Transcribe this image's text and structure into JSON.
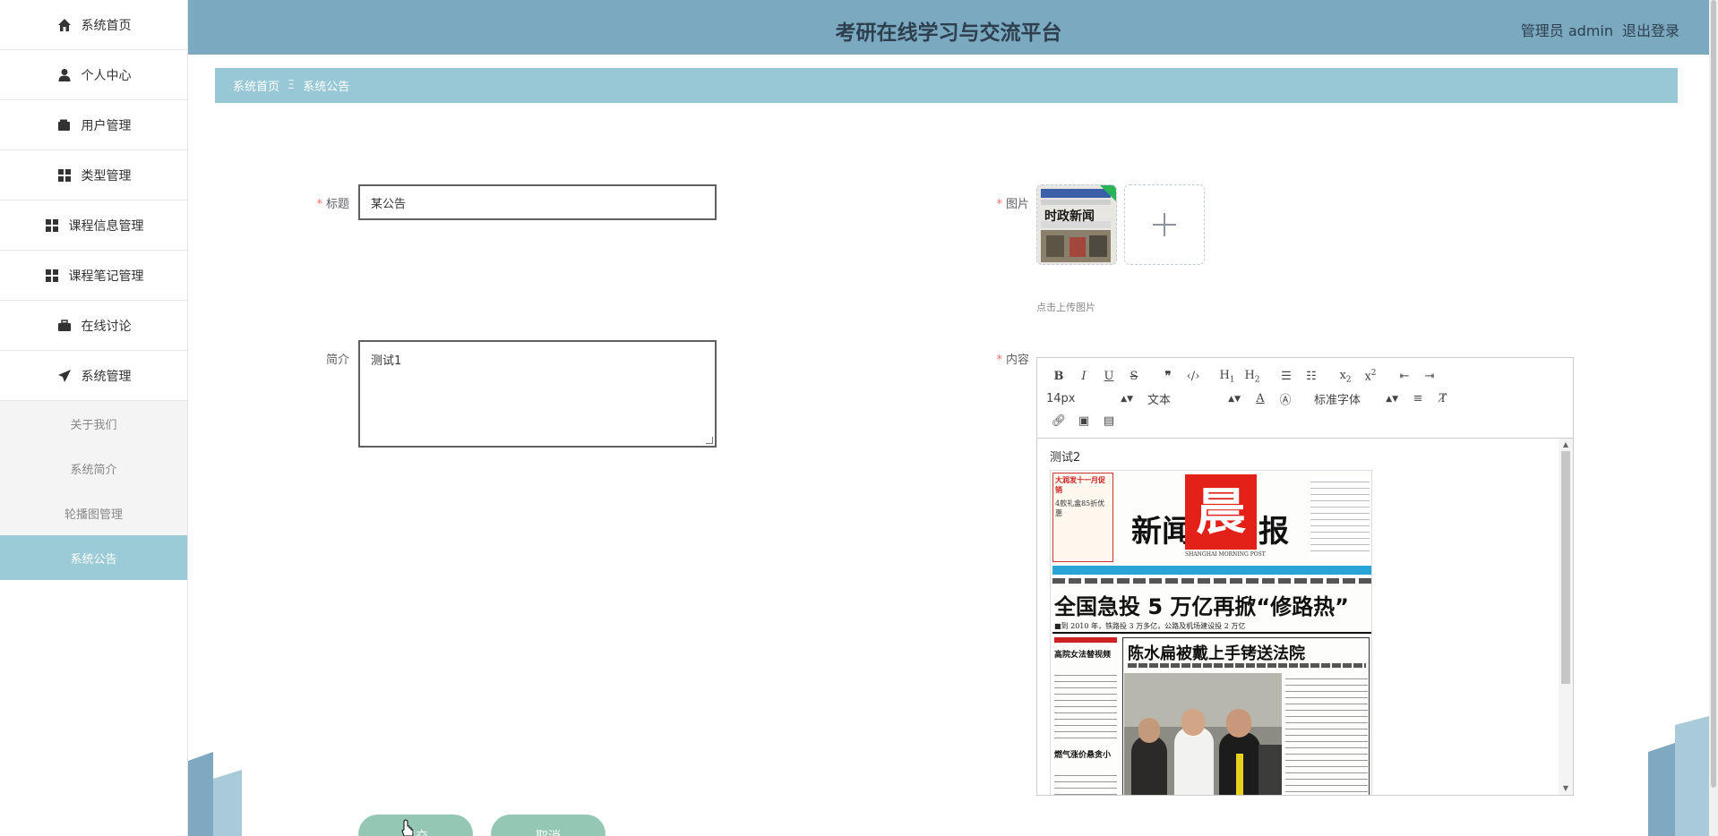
{
  "app": {
    "title": "考研在线学习与交流平台",
    "user_label": "管理员 admin",
    "logout_label": "退出登录"
  },
  "sidebar": {
    "items": [
      {
        "label": "系统首页",
        "icon": "home-icon"
      },
      {
        "label": "个人中心",
        "icon": "user-icon"
      },
      {
        "label": "用户管理",
        "icon": "wallet-icon"
      },
      {
        "label": "类型管理",
        "icon": "grid-icon"
      },
      {
        "label": "课程信息管理",
        "icon": "grid-icon"
      },
      {
        "label": "课程笔记管理",
        "icon": "grid-icon"
      },
      {
        "label": "在线讨论",
        "icon": "briefcase-icon"
      },
      {
        "label": "系统管理",
        "icon": "paper-plane-icon"
      }
    ],
    "sub_items": [
      {
        "label": "关于我们",
        "active": false
      },
      {
        "label": "系统简介",
        "active": false
      },
      {
        "label": "轮播图管理",
        "active": false
      },
      {
        "label": "系统公告",
        "active": true
      }
    ]
  },
  "breadcrumb": {
    "home": "系统首页",
    "separator": "Ξ",
    "current": "系统公告"
  },
  "form": {
    "title_label": "标题",
    "title_value": "某公告",
    "summary_label": "简介",
    "summary_value": "测试1",
    "image_label": "图片",
    "upload_hint": "点击上传图片",
    "content_label": "内容",
    "content_text": "测试2",
    "required_mark": "*"
  },
  "editor": {
    "font_size": "14px",
    "paragraph": "文本",
    "font_family": "标准字体"
  },
  "newspaper": {
    "ad_title": "大润发十一月促销",
    "ad_line": "4款礼盒85折优惠",
    "masthead_left": "新闻",
    "masthead_char": "晨",
    "masthead_right": "报",
    "masthead_en": "SHANGHAI MORNING POST",
    "headline": "全国急投 5 万亿再掀“修路热”",
    "subhead": "■到 2010 年，铁路投 3 万多亿，公路及机场建设投 2 万亿",
    "story_title": "陈水扁被戴上手铐送法院",
    "side_title_1": "高院女法替视频",
    "side_title_2": "燃气涨价悬贪小",
    "thumb_text": "时政新闻"
  },
  "buttons": {
    "submit": "提交",
    "cancel": "取消"
  },
  "colors": {
    "header": "#7ba9c0",
    "breadcrumb": "#98c8d5",
    "active_menu": "#9bcbd6",
    "button": "#94c8b4",
    "required": "#f56c6c"
  }
}
